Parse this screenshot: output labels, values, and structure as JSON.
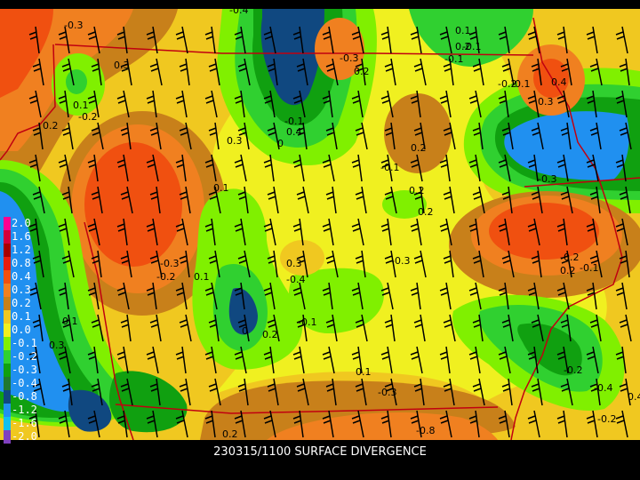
{
  "title": "230315/1100 SURFACE DIVERGENCE",
  "legend": [
    {
      "label": "2.0",
      "color": "#ff0090"
    },
    {
      "label": "1.6",
      "color": "#d4003a"
    },
    {
      "label": "1.2",
      "color": "#a80000"
    },
    {
      "label": "0.8",
      "color": "#e81c10"
    },
    {
      "label": "0.4",
      "color": "#f05010"
    },
    {
      "label": "0.3",
      "color": "#f08020"
    },
    {
      "label": "0.2",
      "color": "#c8801a"
    },
    {
      "label": "0.1",
      "color": "#f0c820"
    },
    {
      "label": "0.0",
      "color": "#f0f020"
    },
    {
      "label": "-0.1",
      "color": "#80f000"
    },
    {
      "label": "-0.2",
      "color": "#30d030"
    },
    {
      "label": "-0.3",
      "color": "#10a010"
    },
    {
      "label": "-0.4",
      "color": "#207830"
    },
    {
      "label": "-0.8",
      "color": "#104880"
    },
    {
      "label": "-1.2",
      "color": "#2090f0"
    },
    {
      "label": "-1.6",
      "color": "#10c0f0"
    },
    {
      "label": "-2.0",
      "color": "#8040c0"
    }
  ],
  "contour_labels": [
    "-0.4",
    "-0.3",
    "0.3",
    "0.1",
    "0.2",
    "-0.2",
    "-0.1",
    "0.4",
    "0",
    "0.3",
    "-0.3",
    "0.2",
    "-0.1",
    "0.1",
    "0.2",
    "-0.2",
    "0.4",
    "0.3",
    "0.2",
    "-0.1",
    "-0.3",
    "0.1",
    "0.2",
    "-0.3",
    "-0.3",
    "-0.2",
    "0.1",
    "0.3",
    "-0.4",
    "-0.1",
    "0",
    "0.2",
    "0.3",
    "0.1",
    "-0.2",
    "-0.1",
    "0.2",
    "-0.2",
    "-0.4",
    "0.4",
    "0.1",
    "-0.3",
    "-0.8",
    "0.2",
    "-0.2",
    "-0.1",
    "-0.1",
    "0.2"
  ]
}
